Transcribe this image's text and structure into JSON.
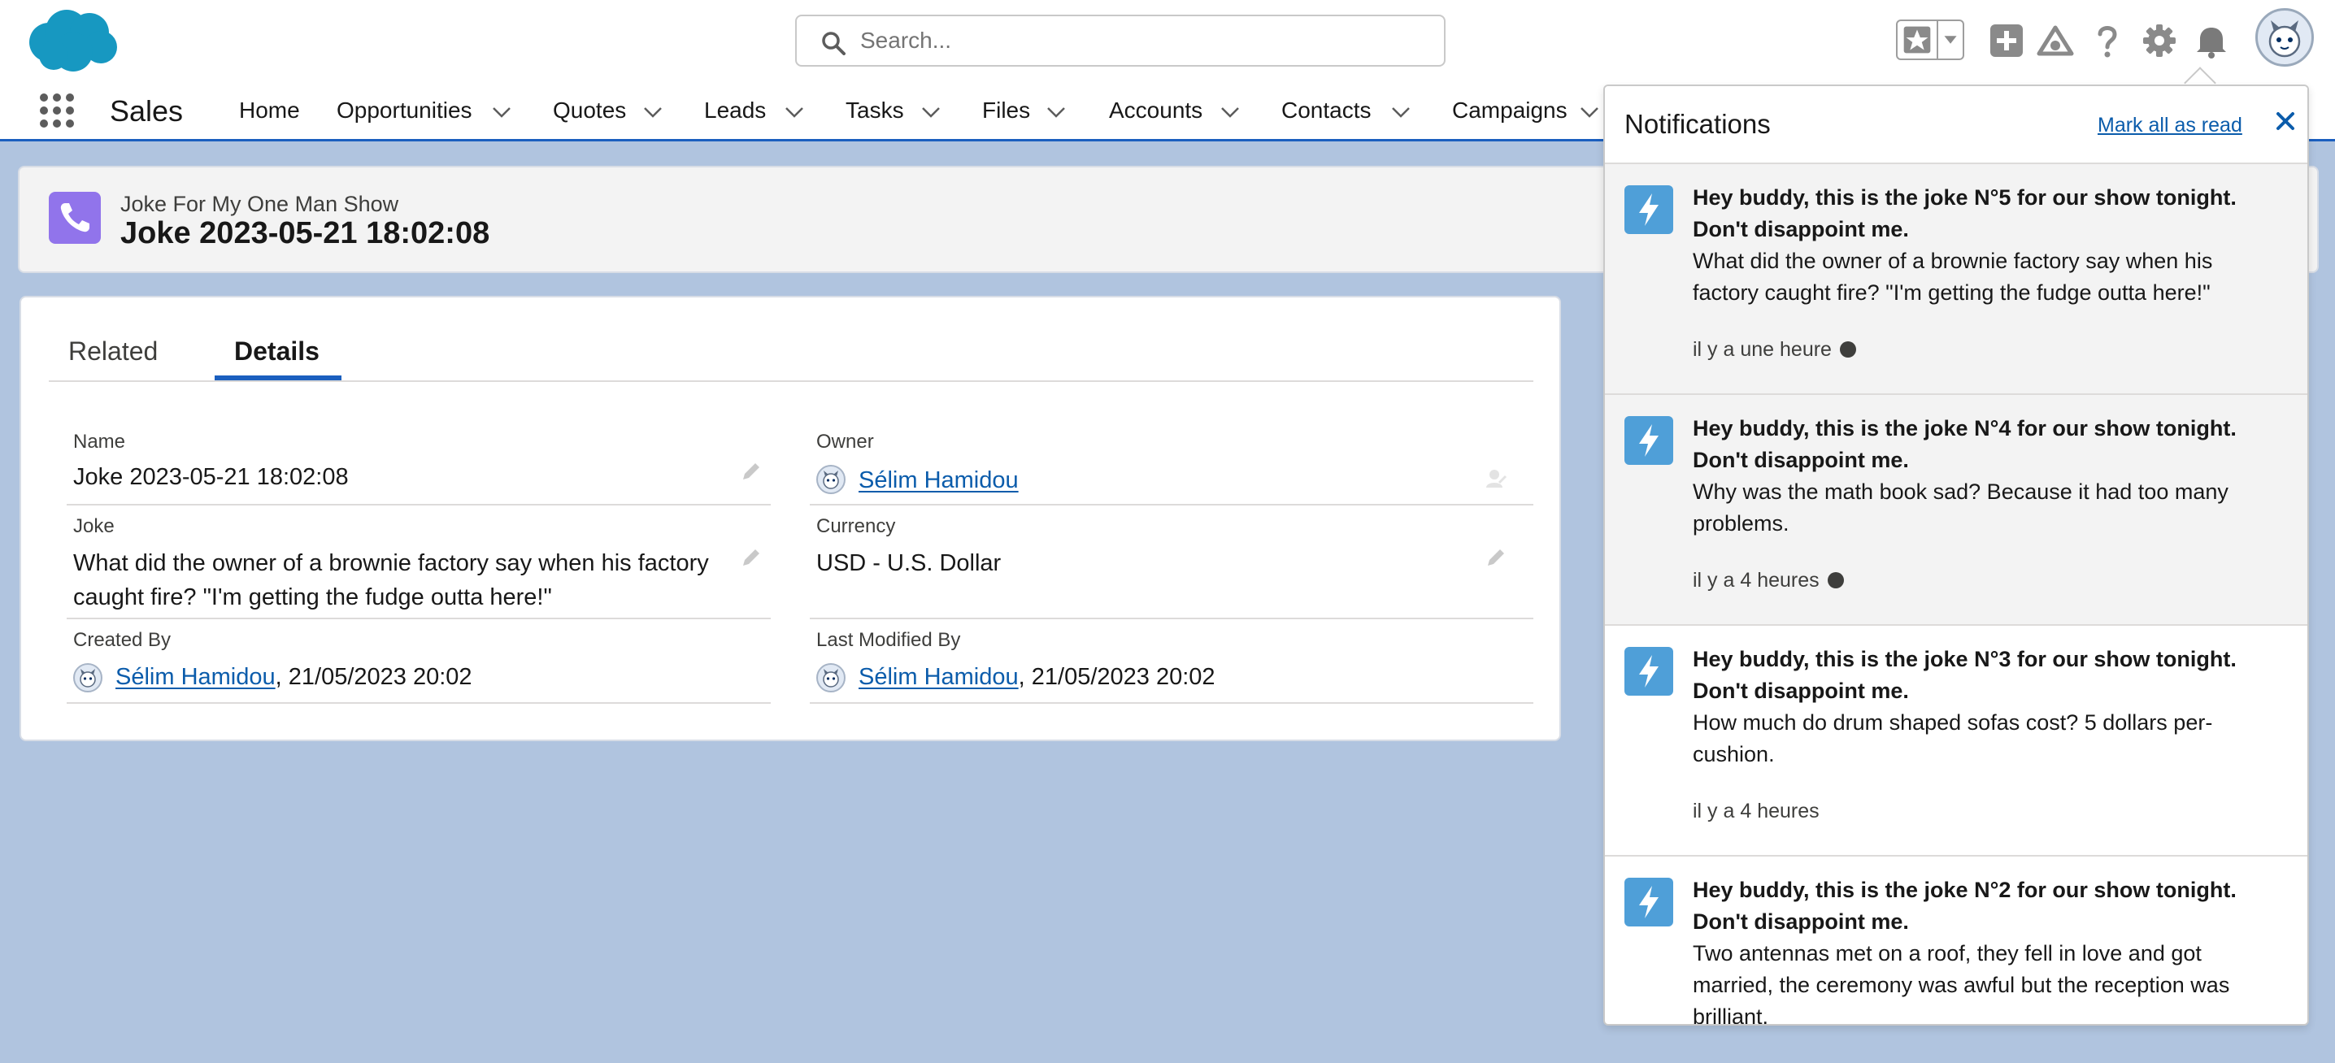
{
  "header": {
    "search_placeholder": "Search...",
    "icons": [
      "favorites-star-icon",
      "favorites-dropdown-icon",
      "global-actions-add-icon",
      "trailhead-icon",
      "help-icon",
      "setup-gear-icon",
      "notifications-bell-icon",
      "user-avatar"
    ]
  },
  "nav": {
    "app_name": "Sales",
    "items": [
      {
        "label": "Home",
        "dropdown": false
      },
      {
        "label": "Opportunities",
        "dropdown": true
      },
      {
        "label": "Quotes",
        "dropdown": true
      },
      {
        "label": "Leads",
        "dropdown": true
      },
      {
        "label": "Tasks",
        "dropdown": true
      },
      {
        "label": "Files",
        "dropdown": true
      },
      {
        "label": "Accounts",
        "dropdown": true
      },
      {
        "label": "Contacts",
        "dropdown": true
      },
      {
        "label": "Campaigns",
        "dropdown": true
      }
    ]
  },
  "record": {
    "object_type": "Joke For My One Man Show",
    "title": "Joke 2023-05-21 18:02:08",
    "icon": "phone-icon",
    "icon_color": "#9174eb"
  },
  "tabs": {
    "related": "Related",
    "details": "Details",
    "active": "Details"
  },
  "fields": {
    "name": {
      "label": "Name",
      "value": "Joke 2023-05-21 18:02:08"
    },
    "owner": {
      "label": "Owner",
      "value": "Sélim Hamidou"
    },
    "joke": {
      "label": "Joke",
      "value_line1": "What did the owner of a brownie factory say when his factory",
      "value_line2": "caught fire? \"I'm getting the fudge outta here!\""
    },
    "currency": {
      "label": "Currency",
      "value": "USD - U.S. Dollar"
    },
    "created_by": {
      "label": "Created By",
      "user": "Sélim Hamidou",
      "date": ", 21/05/2023 20:02"
    },
    "last_modified_by": {
      "label": "Last Modified By",
      "user": "Sélim Hamidou",
      "date": ", 21/05/2023 20:02"
    }
  },
  "notifications": {
    "title": "Notifications",
    "mark_all": "Mark all as read",
    "items": [
      {
        "title": "Hey buddy, this is the joke N°5 for our show tonight. Don't disappoint me.",
        "body": "What did the owner of a brownie factory say when his factory caught fire? \"I'm getting the fudge outta here!\"",
        "time": "il y a une heure",
        "unread": true
      },
      {
        "title": "Hey buddy, this is the joke N°4 for our show tonight. Don't disappoint me.",
        "body": "Why was the math book sad? Because it had too many problems.",
        "time": "il y a 4 heures",
        "unread": true
      },
      {
        "title": "Hey buddy, this is the joke N°3 for our show tonight. Don't disappoint me.",
        "body": "How much do drum shaped sofas cost? 5 dollars per-cushion.",
        "time": "il y a 4 heures",
        "unread": false
      },
      {
        "title": "Hey buddy, this is the joke N°2 for our show tonight. Don't disappoint me.",
        "body": "Two antennas met on a roof, they fell in love and got married, the ceremony was awful but the reception was brilliant.",
        "time": "",
        "unread": false
      }
    ]
  },
  "colors": {
    "brand_blue": "#1b5fbf",
    "link_blue": "#0b5cab",
    "notification_icon": "#4f9fd8",
    "page_background": "#b0c4df"
  }
}
